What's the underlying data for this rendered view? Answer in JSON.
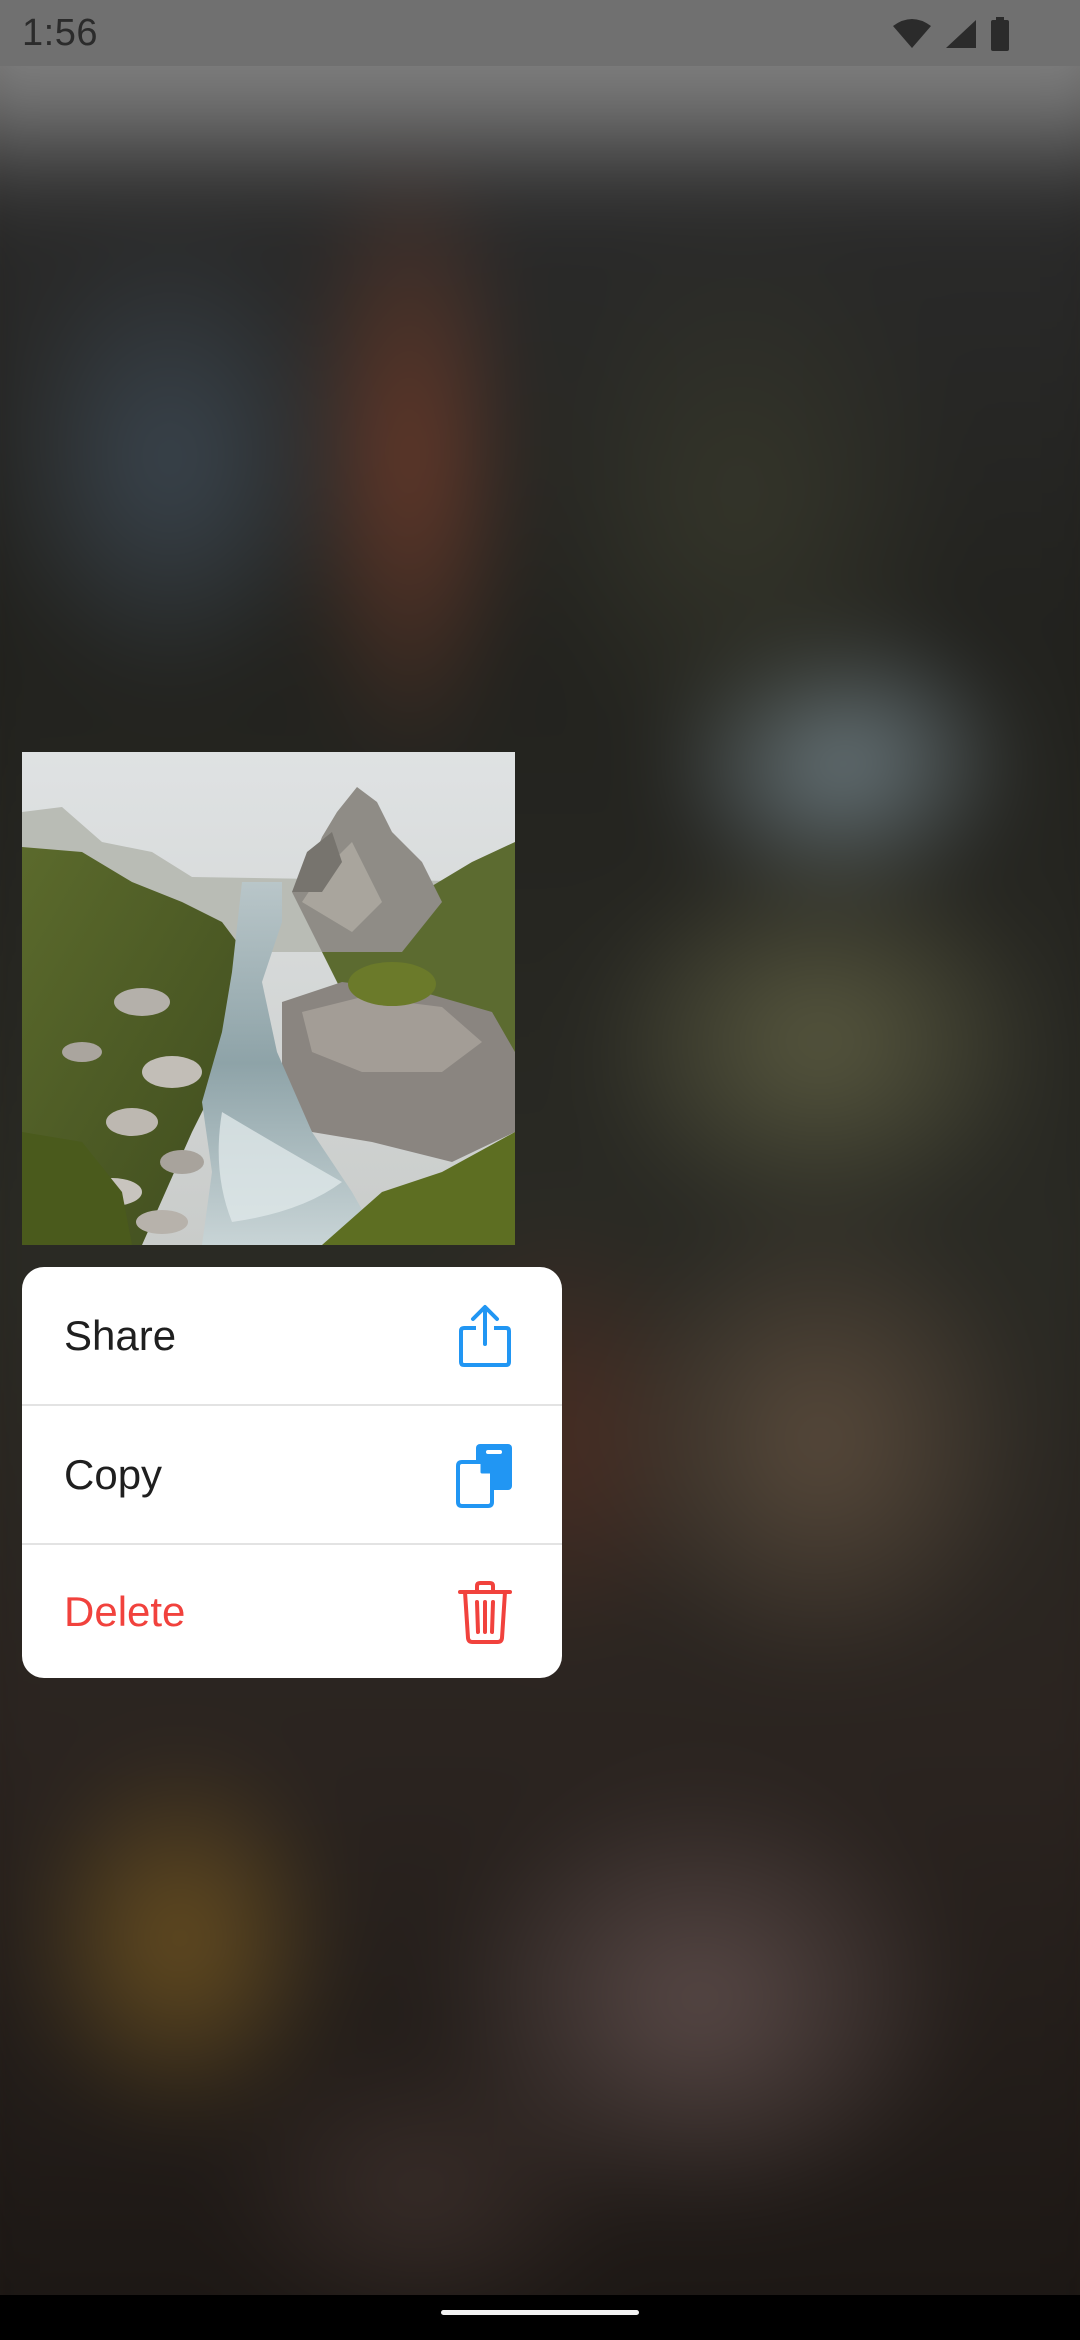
{
  "status_bar": {
    "time": "1:56",
    "icons": [
      "wifi-icon",
      "cell-signal-icon",
      "battery-icon"
    ]
  },
  "preview": {
    "description_icon": "mountain-stream-photo"
  },
  "menu": {
    "items": [
      {
        "label": "Share",
        "icon": "share-icon",
        "color": "#2196f3"
      },
      {
        "label": "Copy",
        "icon": "copy-icon",
        "color": "#2196f3"
      },
      {
        "label": "Delete",
        "icon": "trash-icon",
        "color": "#f1423d"
      }
    ]
  },
  "colors": {
    "accent_blue": "#2196f3",
    "danger_red": "#f1423d",
    "menu_bg": "#ffffff"
  }
}
